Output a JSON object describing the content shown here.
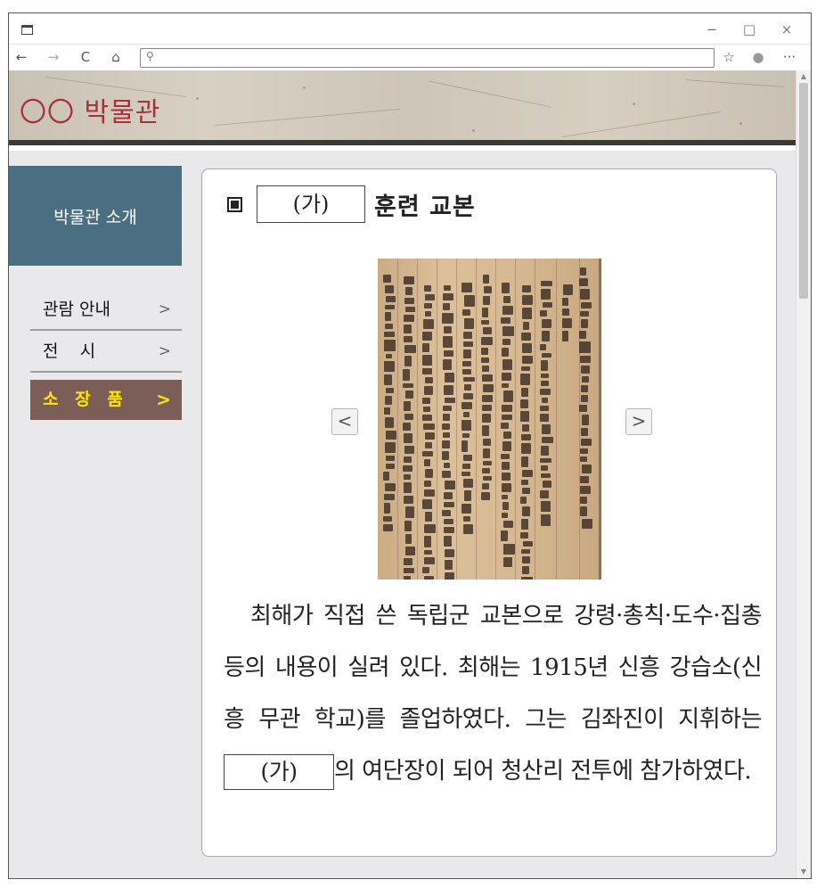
{
  "browser": {
    "window_controls": {
      "minimize": "−",
      "maximize": "□",
      "close": "×"
    },
    "nav": {
      "back": "←",
      "forward": "→",
      "reload": "C",
      "home": "⌂",
      "favorites": "☆",
      "profile": "●",
      "more": "···"
    },
    "address": {
      "icon": "⚲",
      "value": ""
    }
  },
  "site": {
    "title": "〇〇 박물관"
  },
  "sidebar": {
    "heading": "박물관 소개",
    "items": [
      {
        "label": "관람 안내",
        "chevron": ">"
      },
      {
        "label": "전    시",
        "chevron": ">"
      },
      {
        "label": "소 장 품",
        "chevron": ">"
      }
    ]
  },
  "content": {
    "title_blank": "(가)",
    "title_suffix": "훈련 교본",
    "viewer": {
      "prev": "<",
      "next": ">"
    },
    "description": {
      "part1": "최해가 직접 쓴 독립군 교본으로 강령·총칙·도수·집총 등의 내용이 실려 있다. 최해는 1915년 신흥 강습소(신흥 무관 학교)를 졸업하였다. 그는 김좌진이 지휘하는 ",
      "blank": "(가)",
      "part2": "의 여단장이 되어 청산리 전투에 참가하였다."
    }
  }
}
